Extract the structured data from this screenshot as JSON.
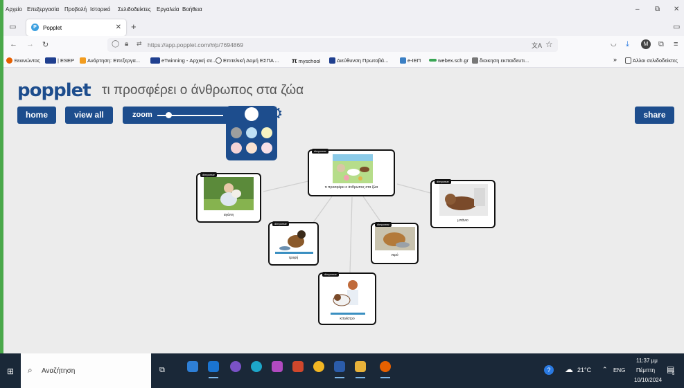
{
  "menu": [
    "Αρχείο",
    "Επεξεργασία",
    "Προβολή",
    "Ιστορικό",
    "Σελιδοδείκτες",
    "Εργαλεία",
    "Βοήθεια"
  ],
  "window_controls": {
    "minimize": "–",
    "restore": "⧉",
    "close": "✕"
  },
  "tab": {
    "favicon": "P",
    "title": "Popplet",
    "close": "✕",
    "new": "+"
  },
  "nav": {
    "back": "←",
    "forward": "→",
    "reload": "↻",
    "url": "https://app.popplet.com/#/p/7694869",
    "translate": "文A",
    "star": "☆"
  },
  "toolbar_icons": [
    "pocket-icon",
    "download-icon",
    "account-icon",
    "extensions-icon",
    "menu-icon"
  ],
  "bookmarks": [
    {
      "label": "Ξεκινώντας",
      "color": "#e66000"
    },
    {
      "label": "| ESEP",
      "color": "#1f3f8f"
    },
    {
      "label": "Ανάρτηση: Επεξεργα...",
      "color": "#f29c1f"
    },
    {
      "label": "eTwinning - Αρχική σε...",
      "color": "#1f3f8f"
    },
    {
      "label": "Επιτελική Δομή ΕΣΠΑ ...",
      "color": "#555555"
    },
    {
      "label": "myschool",
      "color": "#000000"
    },
    {
      "label": "Διεύθυνση Πρωτοβά...",
      "color": "#1f3f8f"
    },
    {
      "label": "e-IEП",
      "color": "#3a7fc4"
    },
    {
      "label": "webex.sch.gr",
      "color": "#3aa655"
    },
    {
      "label": "διοικηση εκπαιδευτι...",
      "color": "#777777"
    }
  ],
  "bookmarks_more": "»",
  "other_bookmarks": "Άλλοι σελιδοδείκτες",
  "popplet": {
    "logo": "popplet",
    "title": "τι προσφέρει ο άνθρωπος στα ζώα",
    "home": "home",
    "view_all": "view all",
    "zoom": "zoom",
    "share": "share",
    "accent": "#1d4d8d"
  },
  "nodes": {
    "center": {
      "tag": "dimpomar",
      "caption": "τι προσφέρει ο άνθρωπος στα ζώα"
    },
    "left": {
      "tag": "dimpomar",
      "caption": "αγάπη"
    },
    "right": {
      "tag": "dimpomar",
      "caption": "μπάνιο"
    },
    "food": {
      "tag": "dimpomar",
      "caption": "τροφή"
    },
    "water": {
      "tag": "dimpomar",
      "caption": "νερό"
    },
    "vet": {
      "tag": "dimpomar",
      "caption": "κτηνίατρο"
    }
  },
  "taskbar": {
    "search_placeholder": "Αναζήτηση",
    "weather": "21°C",
    "lang": "ENG",
    "time": "11:37 μμ",
    "day": "Πέμπτη",
    "date": "10/10/2024",
    "notifications": "5"
  }
}
